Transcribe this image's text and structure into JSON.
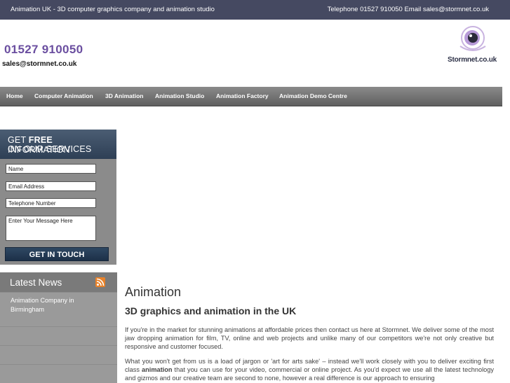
{
  "topbar": {
    "left_text": "Animation UK - 3D computer graphics company and animation studio",
    "right_text": "Telephone 01527 910050 Email sales@stormnet.co.uk"
  },
  "header": {
    "phone": "01527 910050",
    "email": "sales@stormnet.co.uk",
    "logo_text": "Stormnet.co.uk"
  },
  "nav": {
    "items": [
      "Home",
      "Computer Animation",
      "3D Animation",
      "Animation Studio",
      "Animation Factory",
      "Animation Demo Centre"
    ]
  },
  "form": {
    "heading_prefix": "GET",
    "heading_bold": "FREE",
    "heading_suffix": "INFORMATION",
    "heading_line2": "ON OUR SERVICES",
    "name_placeholder": "Name",
    "email_placeholder": "Email Address",
    "phone_placeholder": "Telephone Number",
    "message_placeholder": "Enter Your Message Here",
    "submit_label": "GET IN TOUCH"
  },
  "news": {
    "title": "Latest News",
    "items": [
      "Animation Company in Birmingham"
    ]
  },
  "content": {
    "title": "Animation",
    "subtitle": "3D graphics and animation in the UK",
    "para1": "If you're in the market for stunning animations at affordable prices then contact us here at Stormnet. We deliver some of the most jaw dropping animation for film, TV, online and web projects and unlike many of our competitors we're not only creative but responsive and customer focused.",
    "para2_part1": "What you won't get from us is a load of jargon or 'art for arts sake' – instead we'll work closely with you to deliver exciting first class",
    "para2_bold": "animation",
    "para2_part2": "that you can use for your video, commercial or online project. As you'd expect we use all the latest technology and gizmos and our creative team are second to none, however a real difference is our approach to ensuring"
  },
  "colors": {
    "topbar": "#454961",
    "phone": "#6b4fa0",
    "form_header": "#2e3f55",
    "rss": "#e8822a"
  }
}
